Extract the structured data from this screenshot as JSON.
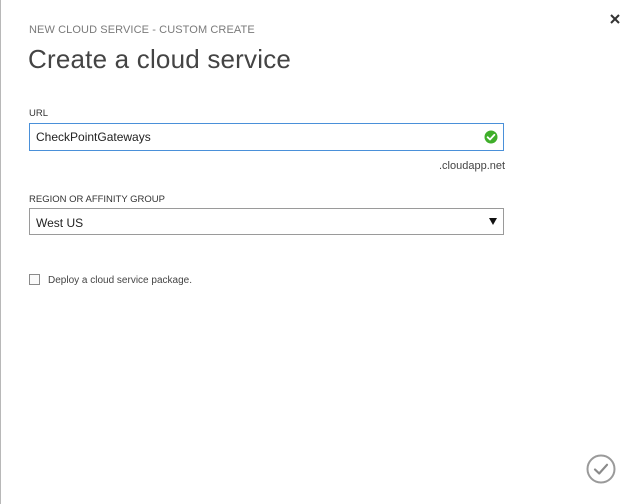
{
  "dialog": {
    "subtitle": "NEW CLOUD SERVICE - CUSTOM CREATE",
    "title": "Create a cloud service",
    "close_icon": "close-icon",
    "confirm_icon": "checkmark-circle-icon"
  },
  "url": {
    "label": "URL",
    "value": "CheckPointGateways",
    "suffix": ".cloudapp.net",
    "status_icon": "valid-checkmark-icon",
    "status_color": "#3fae2a",
    "focus_color": "#4a90d9"
  },
  "region": {
    "label": "REGION OR AFFINITY GROUP",
    "selected": "West US",
    "arrow_icon": "dropdown-arrow-icon"
  },
  "deploy_option": {
    "label": "Deploy a cloud service package.",
    "checked": false
  }
}
